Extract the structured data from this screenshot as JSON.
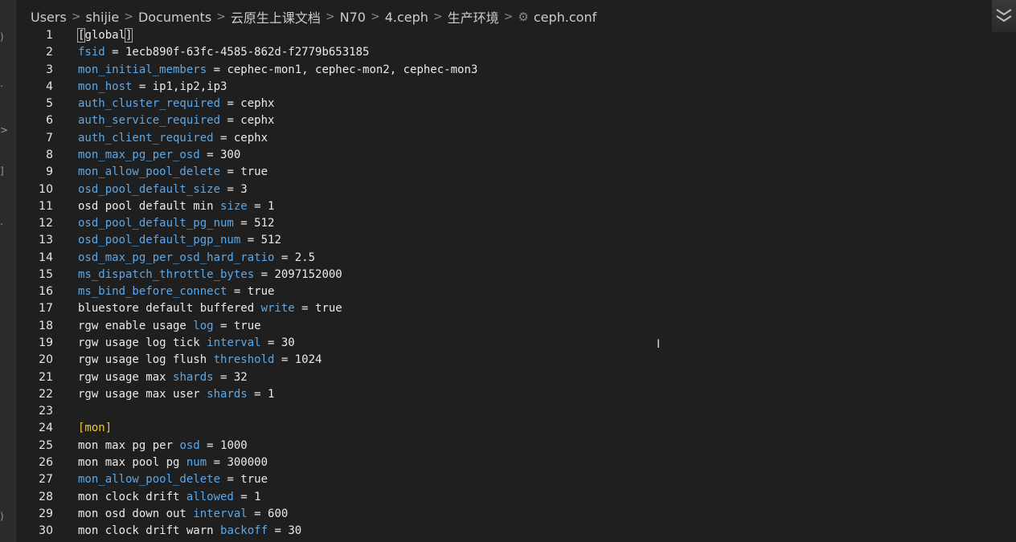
{
  "breadcrumb": {
    "items": [
      "Users",
      "shijie",
      "Documents",
      "云原生上课文档",
      "N70",
      "4.ceph",
      "生产环境"
    ],
    "file": "ceph.conf",
    "separator": ">"
  },
  "editor": {
    "lines": [
      {
        "n": "1",
        "parts": [
          {
            "t": "[",
            "c": "txt",
            "box": true
          },
          {
            "t": "global",
            "c": "txt"
          },
          {
            "t": "]",
            "c": "txt",
            "box": true
          }
        ]
      },
      {
        "n": "2",
        "parts": [
          {
            "t": "fsid",
            "c": "key"
          },
          {
            "t": " = 1ecb890f-63fc-4585-862d-f2779b653185",
            "c": "txt"
          }
        ]
      },
      {
        "n": "3",
        "parts": [
          {
            "t": "mon_initial_members",
            "c": "key"
          },
          {
            "t": " = cephec-mon1, cephec-mon2, cephec-mon3",
            "c": "txt"
          }
        ]
      },
      {
        "n": "4",
        "parts": [
          {
            "t": "mon_host",
            "c": "key"
          },
          {
            "t": " = ip1,ip2,ip3",
            "c": "txt"
          }
        ]
      },
      {
        "n": "5",
        "parts": [
          {
            "t": "auth_cluster_required",
            "c": "key"
          },
          {
            "t": " = cephx",
            "c": "txt"
          }
        ]
      },
      {
        "n": "6",
        "parts": [
          {
            "t": "auth_service_required",
            "c": "key"
          },
          {
            "t": " = cephx",
            "c": "txt"
          }
        ]
      },
      {
        "n": "7",
        "parts": [
          {
            "t": "auth_client_required",
            "c": "key"
          },
          {
            "t": " = cephx",
            "c": "txt"
          }
        ]
      },
      {
        "n": "8",
        "parts": [
          {
            "t": "mon_max_pg_per_osd",
            "c": "key"
          },
          {
            "t": " = 300",
            "c": "txt"
          }
        ]
      },
      {
        "n": "9",
        "parts": [
          {
            "t": "mon_allow_pool_delete",
            "c": "key"
          },
          {
            "t": " = true",
            "c": "txt"
          }
        ]
      },
      {
        "n": "10",
        "parts": [
          {
            "t": "osd_pool_default_size",
            "c": "key"
          },
          {
            "t": " = 3",
            "c": "txt"
          }
        ]
      },
      {
        "n": "11",
        "parts": [
          {
            "t": "osd pool default min ",
            "c": "txt"
          },
          {
            "t": "size",
            "c": "key"
          },
          {
            "t": " = 1",
            "c": "txt"
          }
        ]
      },
      {
        "n": "12",
        "parts": [
          {
            "t": "osd_pool_default_pg_num",
            "c": "key"
          },
          {
            "t": " = 512",
            "c": "txt"
          }
        ]
      },
      {
        "n": "13",
        "parts": [
          {
            "t": "osd_pool_default_pgp_num",
            "c": "key"
          },
          {
            "t": " = 512",
            "c": "txt"
          }
        ]
      },
      {
        "n": "14",
        "parts": [
          {
            "t": "osd_max_pg_per_osd_hard_ratio",
            "c": "key"
          },
          {
            "t": " = 2.5",
            "c": "txt"
          }
        ]
      },
      {
        "n": "15",
        "parts": [
          {
            "t": "ms_dispatch_throttle_bytes",
            "c": "key"
          },
          {
            "t": " = 2097152000",
            "c": "txt"
          }
        ]
      },
      {
        "n": "16",
        "parts": [
          {
            "t": "ms_bind_before_connect",
            "c": "key"
          },
          {
            "t": " = true",
            "c": "txt"
          }
        ]
      },
      {
        "n": "17",
        "parts": [
          {
            "t": "bluestore default buffered ",
            "c": "txt"
          },
          {
            "t": "write",
            "c": "key"
          },
          {
            "t": " = true",
            "c": "txt"
          }
        ]
      },
      {
        "n": "18",
        "parts": [
          {
            "t": "rgw enable usage ",
            "c": "txt"
          },
          {
            "t": "log",
            "c": "key"
          },
          {
            "t": " = true",
            "c": "txt"
          }
        ]
      },
      {
        "n": "19",
        "parts": [
          {
            "t": "rgw usage log tick ",
            "c": "txt"
          },
          {
            "t": "interval",
            "c": "key"
          },
          {
            "t": " = 30",
            "c": "txt"
          }
        ]
      },
      {
        "n": "20",
        "parts": [
          {
            "t": "rgw usage log flush ",
            "c": "txt"
          },
          {
            "t": "threshold",
            "c": "key"
          },
          {
            "t": " = 1024",
            "c": "txt"
          }
        ]
      },
      {
        "n": "21",
        "parts": [
          {
            "t": "rgw usage max ",
            "c": "txt"
          },
          {
            "t": "shards",
            "c": "key"
          },
          {
            "t": " = 32",
            "c": "txt"
          }
        ]
      },
      {
        "n": "22",
        "parts": [
          {
            "t": "rgw usage max user ",
            "c": "txt"
          },
          {
            "t": "shards",
            "c": "key"
          },
          {
            "t": " = 1",
            "c": "txt"
          }
        ]
      },
      {
        "n": "23",
        "parts": []
      },
      {
        "n": "24",
        "parts": [
          {
            "t": "[mon]",
            "c": "sec"
          }
        ]
      },
      {
        "n": "25",
        "parts": [
          {
            "t": "mon max pg per ",
            "c": "txt"
          },
          {
            "t": "osd",
            "c": "key"
          },
          {
            "t": " = 1000",
            "c": "txt"
          }
        ]
      },
      {
        "n": "26",
        "parts": [
          {
            "t": "mon max pool pg ",
            "c": "txt"
          },
          {
            "t": "num",
            "c": "key"
          },
          {
            "t": " = 300000",
            "c": "txt"
          }
        ]
      },
      {
        "n": "27",
        "parts": [
          {
            "t": "mon_allow_pool_delete",
            "c": "key"
          },
          {
            "t": " = true",
            "c": "txt"
          }
        ]
      },
      {
        "n": "28",
        "parts": [
          {
            "t": "mon clock drift ",
            "c": "txt"
          },
          {
            "t": "allowed",
            "c": "key"
          },
          {
            "t": " = 1",
            "c": "txt"
          }
        ]
      },
      {
        "n": "29",
        "parts": [
          {
            "t": "mon osd down out ",
            "c": "txt"
          },
          {
            "t": "interval",
            "c": "key"
          },
          {
            "t": " = 600",
            "c": "txt"
          }
        ]
      },
      {
        "n": "30",
        "parts": [
          {
            "t": "mon clock drift warn ",
            "c": "txt"
          },
          {
            "t": "backoff",
            "c": "key"
          },
          {
            "t": " = 30",
            "c": "txt"
          }
        ]
      }
    ]
  },
  "colors": {
    "background": "#1f1f1f",
    "key": "#5aa8ea",
    "text": "#eaeaea",
    "section": "#f0c43a"
  },
  "icons": {
    "file_icon": "gear-icon",
    "corner_icon": "chevron-collapse-icon",
    "cursor": "text-cursor-icon"
  }
}
